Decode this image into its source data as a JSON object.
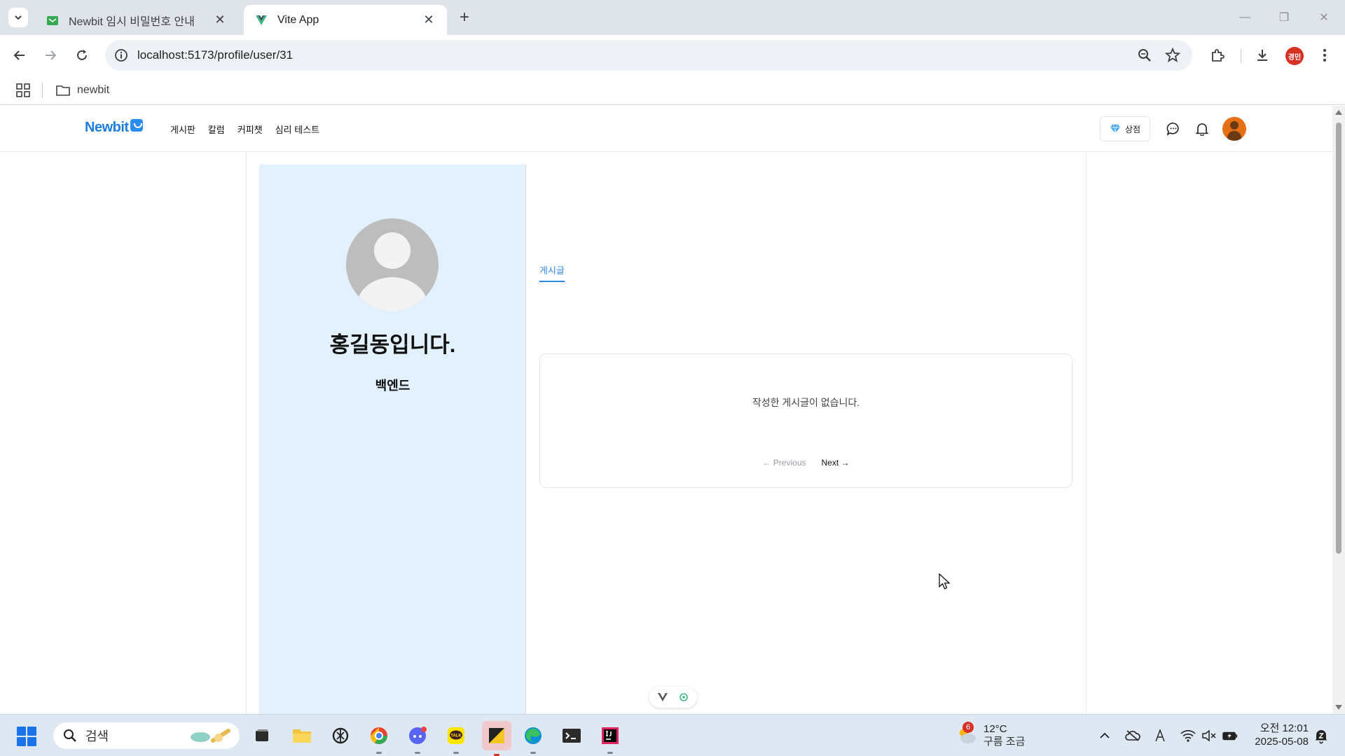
{
  "browser": {
    "tabs": [
      {
        "title": "Newbit 임시 비밀번호 안내",
        "active": false
      },
      {
        "title": "Vite App",
        "active": true
      }
    ],
    "url": "localhost:5173/profile/user/31",
    "profile_badge": "경민",
    "bookmarks": [
      {
        "label": "newbit"
      }
    ]
  },
  "app": {
    "logo": "Newbit",
    "nav": [
      "게시판",
      "칼럼",
      "커피챗",
      "심리 테스트"
    ],
    "shop_label": "상점"
  },
  "profile": {
    "name": "홍길동입니다.",
    "role": "백엔드"
  },
  "posts": {
    "tab_label": "게시글",
    "empty_message": "작성한 게시글이 없습니다.",
    "prev_label": "← Previous",
    "next_label": "Next →"
  },
  "taskbar": {
    "search_placeholder": "검색",
    "weather": {
      "temp": "12°C",
      "desc": "구름 조금",
      "badge": "6"
    },
    "clock": {
      "time": "오전 12:01",
      "date": "2025-05-08"
    }
  },
  "colors": {
    "accent": "#2c8be8",
    "profile_bg": "#e2f1fd"
  }
}
